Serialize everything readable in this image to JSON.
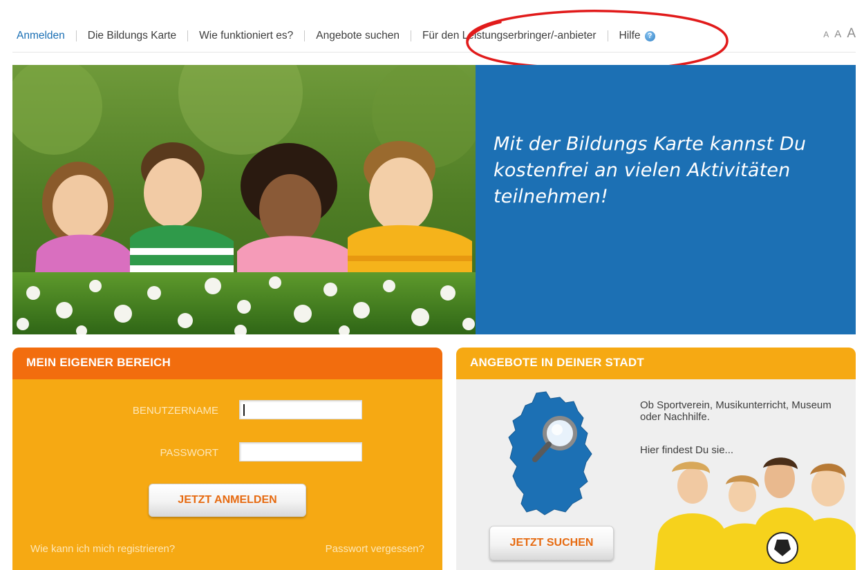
{
  "nav": {
    "items": [
      {
        "label": "Anmelden",
        "active": true
      },
      {
        "label": "Die Bildungs Karte"
      },
      {
        "label": "Wie funktioniert es?"
      },
      {
        "label": "Angebote suchen"
      },
      {
        "label": "Für den Leistungserbringer/-anbieter"
      },
      {
        "label": "Hilfe"
      }
    ],
    "font_sizes": [
      "A",
      "A",
      "A"
    ],
    "icons": {
      "help": "help-icon"
    }
  },
  "hero": {
    "tagline": "Mit der Bildungs Karte kannst Du kostenfrei an vielen Aktivitäten teilnehmen!"
  },
  "login": {
    "title": "MEIN EIGENER BEREICH",
    "username_label": "BENUTZERNAME",
    "password_label": "PASSWORT",
    "username_value": "",
    "password_value": "",
    "submit_label": "JETZT ANMELDEN",
    "register_link": "Wie kann ich mich registrieren?",
    "forgot_link": "Passwort vergessen?"
  },
  "offers": {
    "title": "ANGEBOTE IN DEINER STADT",
    "description": "Ob Sportverein, Musikunterricht, Museum oder Nachhilfe.",
    "hint": "Hier findest Du sie...",
    "search_label": "JETZT SUCHEN",
    "icons": {
      "map": "germany-map-icon",
      "magnifier": "magnifier-icon"
    }
  },
  "colors": {
    "link_blue": "#1a6fb4",
    "hero_blue": "#1c70b4",
    "orange_header": "#f26d0e",
    "amber": "#f6a913",
    "annotation_red": "#e11b1b"
  }
}
